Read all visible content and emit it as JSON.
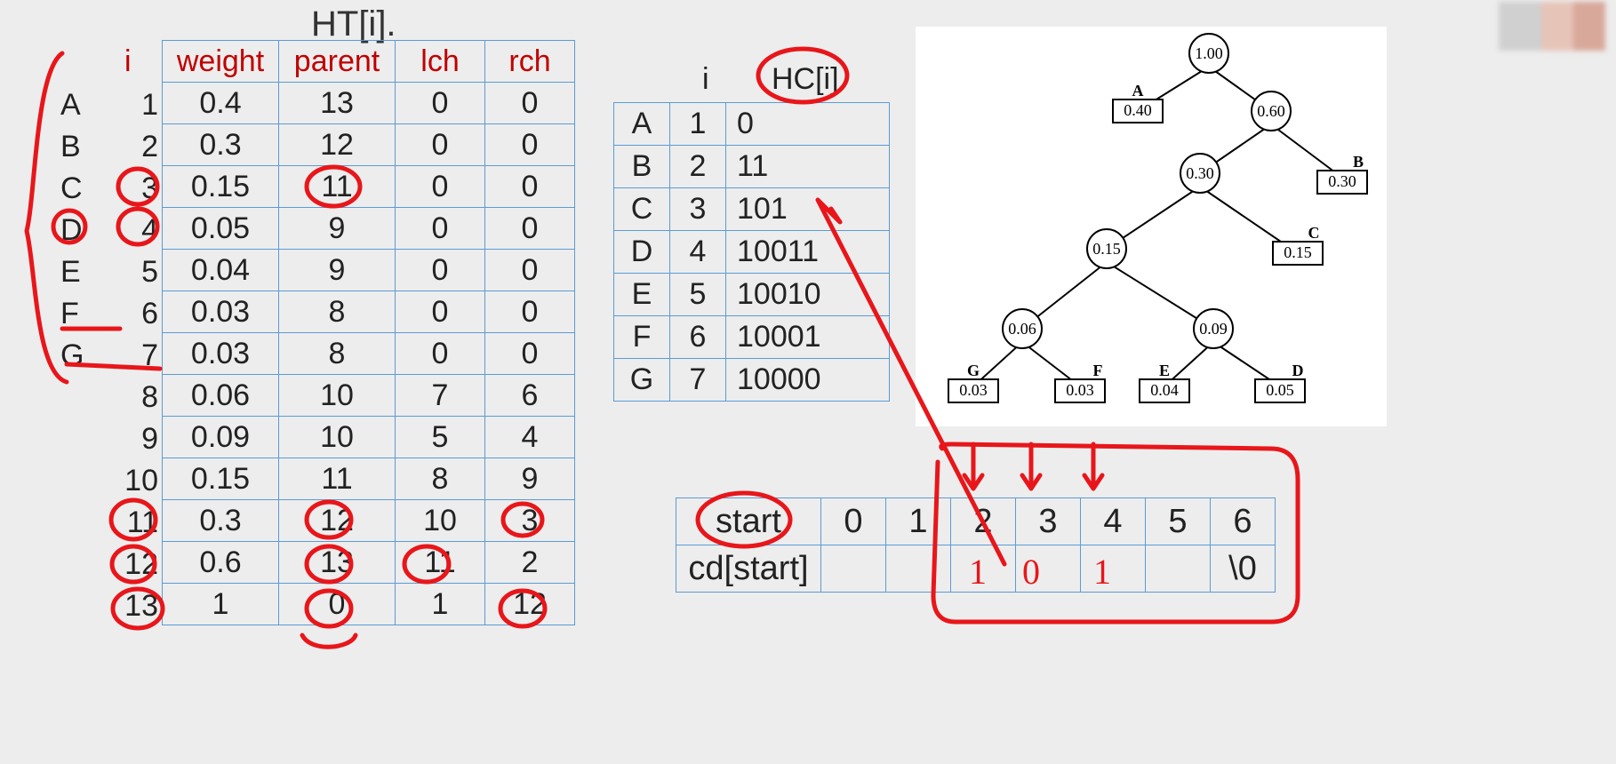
{
  "ht": {
    "title": "HT[i].",
    "i_head": "i",
    "headers": {
      "weight": "weight",
      "parent": "parent",
      "lch": "lch",
      "rch": "rch"
    },
    "rows": [
      {
        "label": "A",
        "i": "1",
        "w": "0.4",
        "p": "13",
        "l": "0",
        "r": "0"
      },
      {
        "label": "B",
        "i": "2",
        "w": "0.3",
        "p": "12",
        "l": "0",
        "r": "0"
      },
      {
        "label": "C",
        "i": "3",
        "w": "0.15",
        "p": "11",
        "l": "0",
        "r": "0"
      },
      {
        "label": "D",
        "i": "4",
        "w": "0.05",
        "p": "9",
        "l": "0",
        "r": "0"
      },
      {
        "label": "E",
        "i": "5",
        "w": "0.04",
        "p": "9",
        "l": "0",
        "r": "0"
      },
      {
        "label": "F",
        "i": "6",
        "w": "0.03",
        "p": "8",
        "l": "0",
        "r": "0"
      },
      {
        "label": "G",
        "i": "7",
        "w": "0.03",
        "p": "8",
        "l": "0",
        "r": "0"
      },
      {
        "label": "",
        "i": "8",
        "w": "0.06",
        "p": "10",
        "l": "7",
        "r": "6"
      },
      {
        "label": "",
        "i": "9",
        "w": "0.09",
        "p": "10",
        "l": "5",
        "r": "4"
      },
      {
        "label": "",
        "i": "10",
        "w": "0.15",
        "p": "11",
        "l": "8",
        "r": "9"
      },
      {
        "label": "",
        "i": "11",
        "w": "0.3",
        "p": "12",
        "l": "10",
        "r": "3"
      },
      {
        "label": "",
        "i": "12",
        "w": "0.6",
        "p": "13",
        "l": "11",
        "r": "2"
      },
      {
        "label": "",
        "i": "13",
        "w": "1",
        "p": "0",
        "l": "1",
        "r": "12"
      }
    ]
  },
  "hc": {
    "head_i": "i",
    "head_hc": "HC[i]",
    "rows": [
      {
        "a": "A",
        "b": "1",
        "c": "0"
      },
      {
        "a": "B",
        "b": "2",
        "c": "11"
      },
      {
        "a": "C",
        "b": "3",
        "c": "101"
      },
      {
        "a": "D",
        "b": "4",
        "c": "10011"
      },
      {
        "a": "E",
        "b": "5",
        "c": "10010"
      },
      {
        "a": "F",
        "b": "6",
        "c": "10001"
      },
      {
        "a": "G",
        "b": "7",
        "c": "10000"
      }
    ]
  },
  "cd": {
    "r1": [
      "start",
      "0",
      "1",
      "2",
      "3",
      "4",
      "5",
      "6"
    ],
    "r2": [
      "cd[start]",
      "",
      "",
      "",
      "",
      "",
      "",
      "\\0"
    ]
  },
  "tree": {
    "root": "1.00",
    "n060": "0.60",
    "n030": "0.30",
    "n015": "0.15",
    "n006": "0.06",
    "n009": "0.09",
    "A": {
      "lab": "A",
      "v": "0.40"
    },
    "B": {
      "lab": "B",
      "v": "0.30"
    },
    "C": {
      "lab": "C",
      "v": "0.15"
    },
    "D": {
      "lab": "D",
      "v": "0.05"
    },
    "E": {
      "lab": "E",
      "v": "0.04"
    },
    "F": {
      "lab": "F",
      "v": "0.03"
    },
    "G": {
      "lab": "G",
      "v": "0.03"
    }
  },
  "ink": {
    "cd3": "1",
    "cd4": "0",
    "cd5": "1"
  }
}
